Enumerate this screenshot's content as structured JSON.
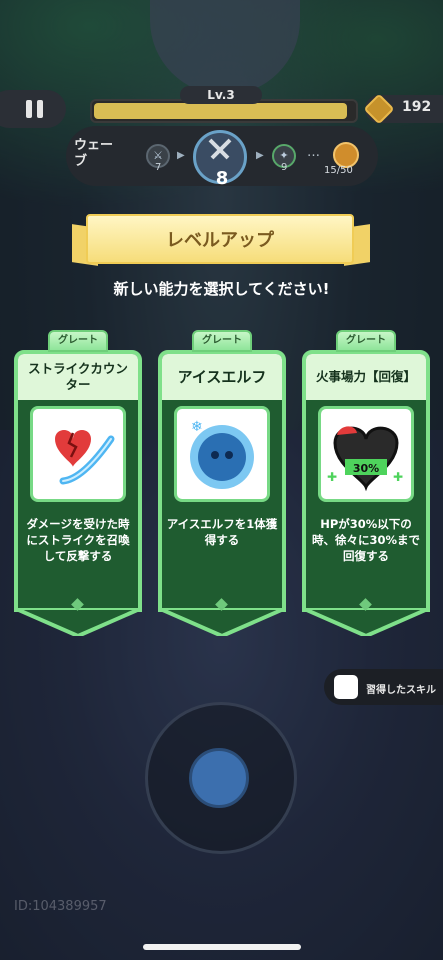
{
  "hud": {
    "level": "Lv.3",
    "xp_progress": 0.99,
    "coins": "192",
    "wave_label": "ウェーブ",
    "wave_prev": "7",
    "wave_current": "8",
    "wave_next": "9",
    "wave_dots": "…",
    "boss_count": "15/50"
  },
  "levelup": {
    "title": "レベルアップ",
    "subtitle": "新しい能力を選択してください!"
  },
  "cards": [
    {
      "rarity": "グレート",
      "title": "ストライクカウンター",
      "desc": "ダメージを受けた時にストライクを召喚して反撃する",
      "icon": "broken-heart-sword-icon"
    },
    {
      "rarity": "グレート",
      "title": "アイスエルフ",
      "desc": "アイスエルフを1体獲得する",
      "icon": "ice-elf-icon"
    },
    {
      "rarity": "グレート",
      "title": "火事場力【回復】",
      "desc": "HPが30%以下の時、徐々に30%まで回復する",
      "icon": "heart-heal-icon",
      "icon_label": "30%"
    }
  ],
  "skills_button": "習得したスキル",
  "player_id": "ID:104389957",
  "colors": {
    "card_border": "#7fe08a",
    "card_body": "#1f5c30",
    "banner": "#f6dd7a"
  }
}
